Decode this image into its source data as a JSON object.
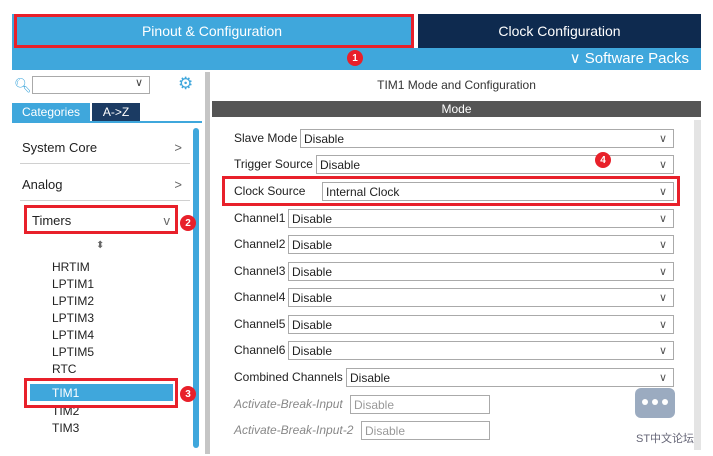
{
  "header": {
    "pinout_tab": "Pinout & Configuration",
    "clock_tab": "Clock Configuration",
    "software_packs": "Software Packs"
  },
  "left": {
    "tabs": {
      "categories": "Categories",
      "az": "A->Z"
    },
    "categories": [
      {
        "label": "System Core",
        "arrow": ">"
      },
      {
        "label": "Analog",
        "arrow": ">"
      },
      {
        "label": "Timers",
        "arrow": "v"
      }
    ],
    "timers": [
      "HRTIM",
      "LPTIM1",
      "LPTIM2",
      "LPTIM3",
      "LPTIM4",
      "LPTIM5",
      "RTC"
    ],
    "selected": "TIM1",
    "after": [
      "TIM2",
      "TIM3"
    ]
  },
  "right": {
    "title": "TIM1 Mode and Configuration",
    "mode_header": "Mode",
    "rows": [
      {
        "label": "Slave Mode",
        "value": "Disable"
      },
      {
        "label": "Trigger Source",
        "value": "Disable"
      },
      {
        "label": "Clock Source",
        "value": "Internal Clock"
      },
      {
        "label": "Channel1",
        "value": "Disable"
      },
      {
        "label": "Channel2",
        "value": "Disable"
      },
      {
        "label": "Channel3",
        "value": "Disable"
      },
      {
        "label": "Channel4",
        "value": "Disable"
      },
      {
        "label": "Channel5",
        "value": "Disable"
      },
      {
        "label": "Channel6",
        "value": "Disable"
      },
      {
        "label": "Combined Channels",
        "value": "Disable"
      },
      {
        "label": "Activate-Break-Input",
        "value": "Disable"
      },
      {
        "label": "Activate-Break-Input-2",
        "value": "Disable"
      }
    ]
  },
  "badges": {
    "b1": "1",
    "b2": "2",
    "b3": "3",
    "b4": "4"
  },
  "watermark": "ST中文论坛",
  "colors": {
    "accent": "#3fa7dc",
    "dark": "#0e2a4f",
    "annotation": "#e8202a"
  },
  "icons": {
    "search": "search-icon",
    "settings": "gear-icon",
    "dropdown": "chevron-down-icon"
  }
}
